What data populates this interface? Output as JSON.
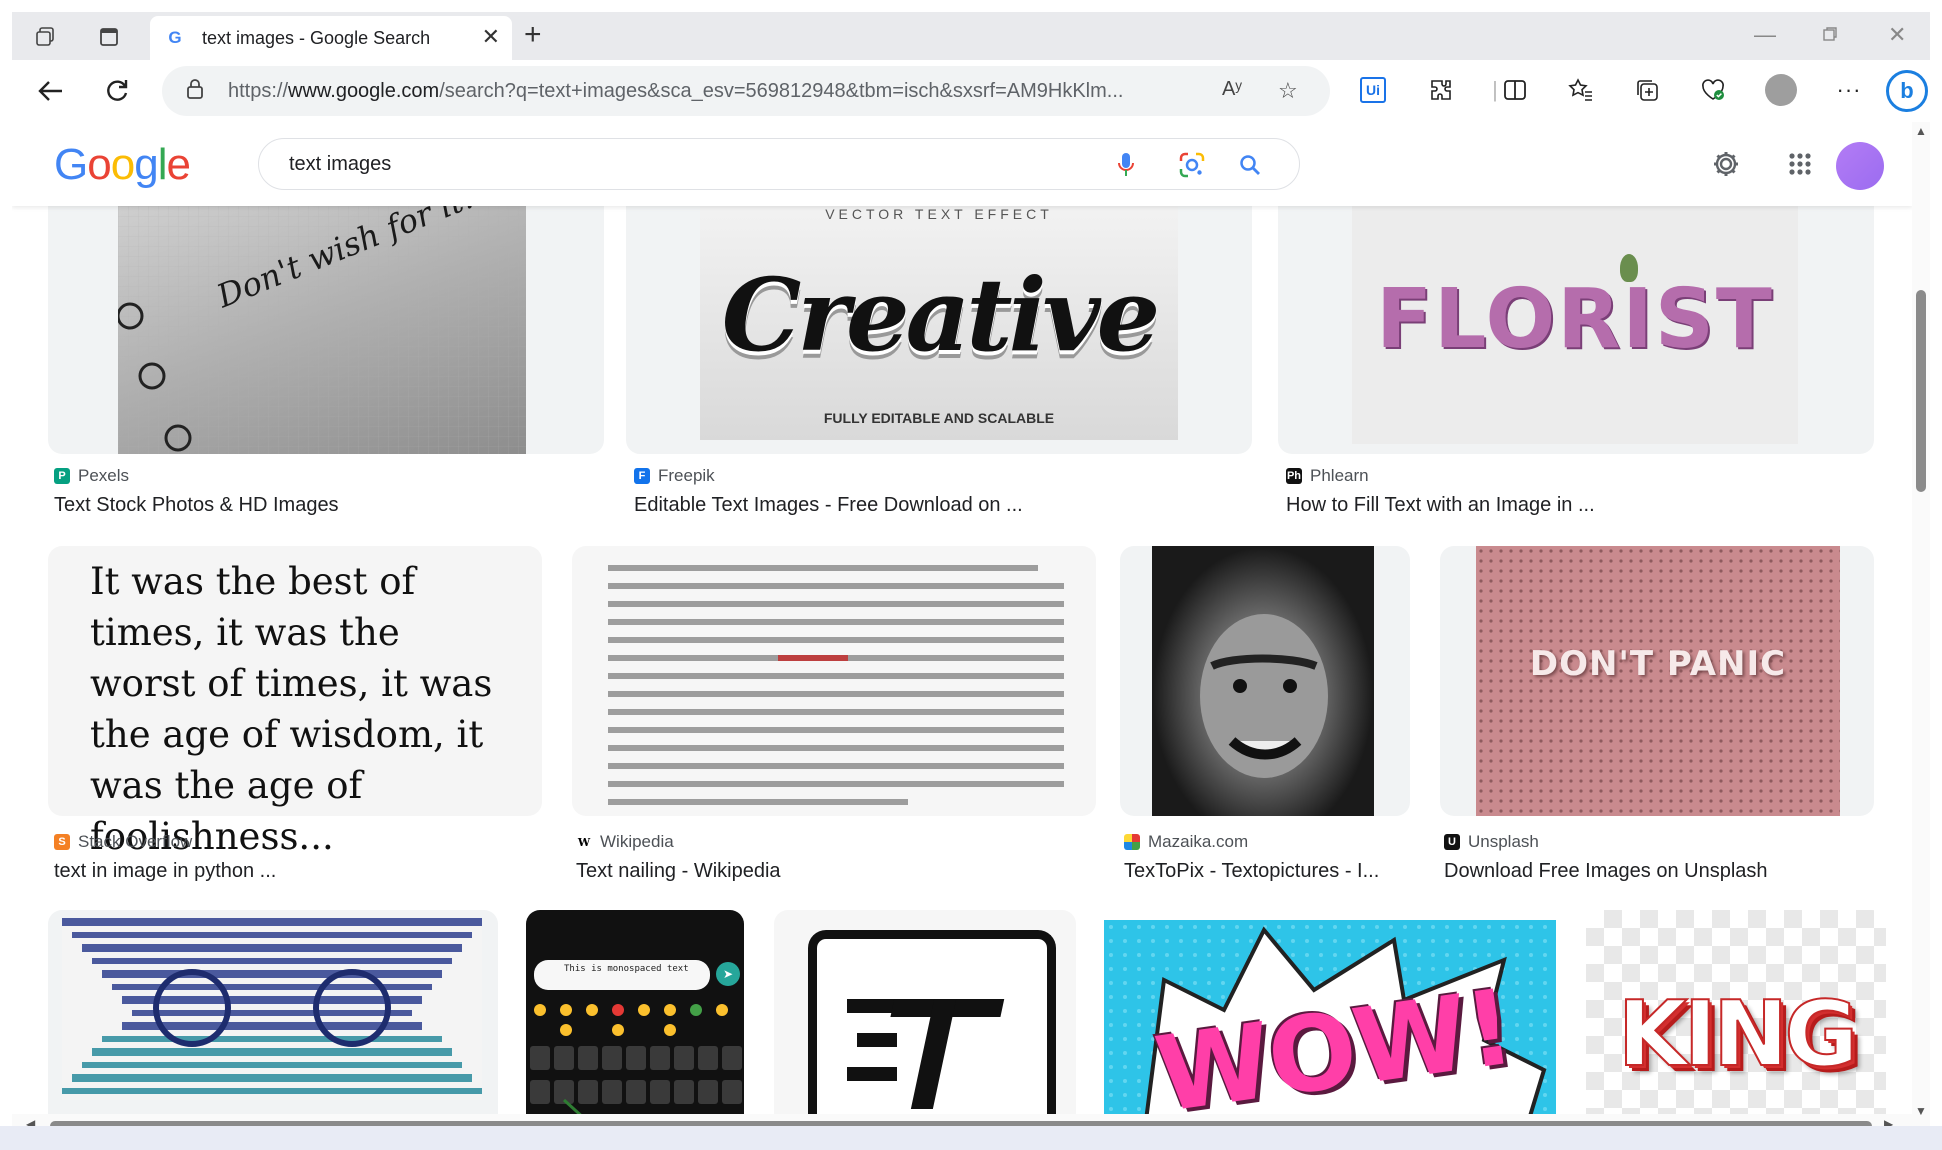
{
  "browser": {
    "tab_title": "text images - Google Search",
    "url_prefix": "https://",
    "url_host": "www.google.com",
    "url_path": "/search?q=text+images&sca_esv=569812948&tbm=isch&sxsrf=AM9HkKlm...",
    "read_aloud_glyph": "Aʸ",
    "extension_label": "Ui"
  },
  "google": {
    "logo_letters": [
      "G",
      "o",
      "o",
      "g",
      "l",
      "e"
    ],
    "search_value": "text images"
  },
  "results": [
    {
      "source": "Pexels",
      "title": "Text Stock Photos & HD Images",
      "image_text": "Don't wish for it. Work for it."
    },
    {
      "source": "Freepik",
      "title": "Editable Text Images - Free Download on ...",
      "image_text": "Creative",
      "image_top": "VECTOR TEXT EFFECT",
      "image_bottom": "FULLY EDITABLE AND SCALABLE"
    },
    {
      "source": "Phlearn",
      "title": "How to Fill Text with an Image in ...",
      "image_text": "FLORIST"
    },
    {
      "source": "Stack Overflow",
      "title": "text in image in python ...",
      "image_text": "It was the best of times, it was the worst of times, it was the age of wisdom, it was the age of foolishness..."
    },
    {
      "source": "Wikipedia",
      "title": "Text nailing - Wikipedia"
    },
    {
      "source": "Mazaika.com",
      "title": "TexToPix - Textopictures - I..."
    },
    {
      "source": "Unsplash",
      "title": "Download Free Images on Unsplash",
      "image_text": "DON'T PANIC"
    },
    {
      "image_text": ""
    },
    {
      "image_text": "This is monospaced text"
    },
    {
      "image_text": "T"
    },
    {
      "image_text": "WOW!"
    },
    {
      "image_text": "KING"
    }
  ],
  "colors": {
    "google_blue": "#4285f4",
    "tab_strip": "#e9eaed",
    "address_bar": "#f1f3f4",
    "avatar": "#a78bf5"
  }
}
